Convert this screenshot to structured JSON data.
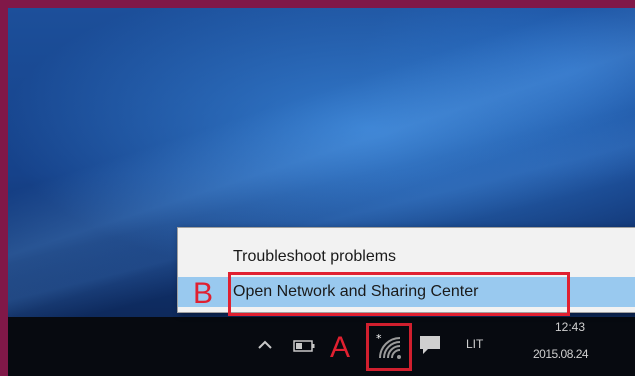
{
  "context_menu": {
    "items": [
      {
        "label": "Troubleshoot problems"
      },
      {
        "label": "Open Network and Sharing Center"
      }
    ]
  },
  "annotations": {
    "label_a": "A",
    "label_b": "B",
    "highlight_color": "#e02030"
  },
  "taskbar": {
    "tray_icons": [
      "chevron-up-icon",
      "battery-icon",
      "wifi-icon",
      "notification-icon"
    ],
    "language": "LIT",
    "clock_time": "12:43",
    "clock_date": "2015.08.24"
  },
  "colors": {
    "menu_bg": "#f2f2f2",
    "menu_highlight": "#99c9ef",
    "taskbar_bg": "#070a10",
    "frame": "#801848"
  }
}
